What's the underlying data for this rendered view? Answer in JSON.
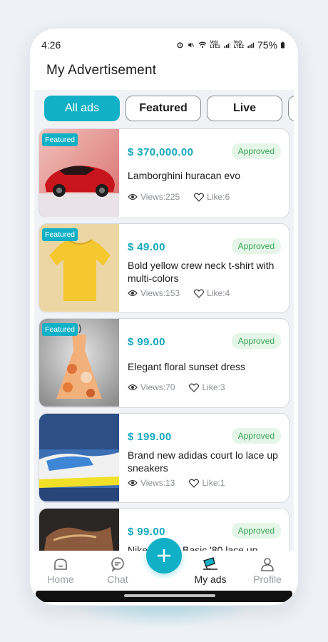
{
  "status_bar": {
    "time": "4:26",
    "network_1": "Vo))\nLTE1",
    "network_2": "Vo))\nLTE2",
    "battery": "75%"
  },
  "header": {
    "title": "My Advertisement"
  },
  "tabs": [
    {
      "label": "All ads",
      "active": true
    },
    {
      "label": "Featured",
      "active": false
    },
    {
      "label": "Live",
      "active": false
    }
  ],
  "ads": [
    {
      "badge": "Featured",
      "price": "$ 370,000.00",
      "status": "Approved",
      "title": "Lamborghini huracan evo",
      "views": "Views:225",
      "likes": "Like:6"
    },
    {
      "badge": "Featured",
      "price": "$ 49.00",
      "status": "Approved",
      "title": "Bold yellow crew neck t-shirt with multi-colors",
      "views": "Views:153",
      "likes": "Like:4"
    },
    {
      "badge": "Featured",
      "price": "$ 99.00",
      "status": "Approved",
      "title": "Elegant floral sunset dress",
      "views": "Views:70",
      "likes": "Like:3"
    },
    {
      "price": "$ 199.00",
      "status": "Approved",
      "title": "Brand new adidas court lo lace up sneakers",
      "views": "Views:13",
      "likes": "Like:1"
    },
    {
      "price": "$ 99.00",
      "status": "Approved",
      "title": "Nike Cortez Basic '80 lace up"
    }
  ],
  "bottom_nav": [
    {
      "label": "Home",
      "icon": "home-icon",
      "active": false
    },
    {
      "label": "Chat",
      "icon": "chat-icon",
      "active": false
    },
    {
      "label": "My ads",
      "icon": "ads-icon",
      "active": true
    },
    {
      "label": "Profile",
      "icon": "profile-icon",
      "active": false
    }
  ],
  "colors": {
    "accent": "#12b0c6",
    "approved_bg": "#e5f6e8",
    "approved_text": "#3aa558"
  }
}
